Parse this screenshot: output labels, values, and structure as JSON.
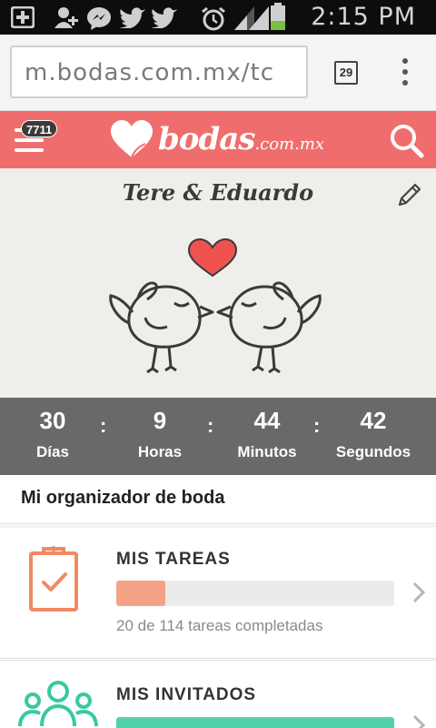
{
  "status_bar": {
    "time": "2:15 PM",
    "icons": [
      "add-icon",
      "contact-add-icon",
      "messenger-icon",
      "twitter-icon",
      "twitter-icon",
      "alarm-icon",
      "signal-icon",
      "signal-icon",
      "battery-icon"
    ]
  },
  "browser": {
    "url": "m.bodas.com.mx/tc",
    "tab_count": "29"
  },
  "site_header": {
    "notifications": "7711",
    "logo_word": "bodas",
    "logo_domain": ".com.mx"
  },
  "hero": {
    "couple_names": "Tere & Eduardo"
  },
  "countdown": {
    "days": {
      "value": "30",
      "label": "Días"
    },
    "hours": {
      "value": "9",
      "label": "Horas"
    },
    "minutes": {
      "value": "44",
      "label": "Minutos"
    },
    "seconds": {
      "value": "42",
      "label": "Segundos"
    },
    "separator": ":"
  },
  "organizer": {
    "title": "Mi organizador de boda",
    "tasks": {
      "title": "MIS TAREAS",
      "progress": 0.1754,
      "summary": "20 de 114 tareas completadas",
      "color": "#f5a386"
    },
    "guests": {
      "title": "MIS INVITADOS",
      "progress": 1.0,
      "color": "#52d2aa"
    }
  },
  "colors": {
    "brand": "#ef6e6d",
    "countdown_bg": "#696969",
    "hero_bg": "#efeeeb"
  }
}
